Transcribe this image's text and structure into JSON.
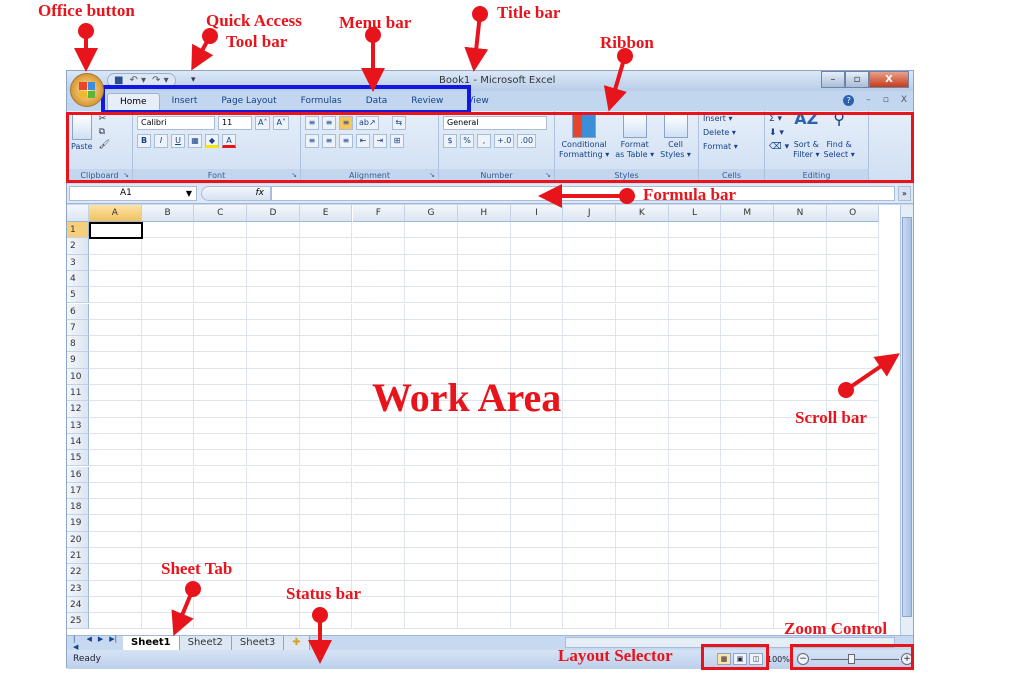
{
  "annotations": {
    "office_button": "Office button",
    "quick_access_line1": "Quick Access",
    "quick_access_line2": "Tool bar",
    "menu_bar": "Menu bar",
    "title_bar": "Title bar",
    "ribbon": "Ribbon",
    "formula_bar": "Formula bar",
    "work_area": "Work Area",
    "scroll_bar": "Scroll bar",
    "sheet_tab": "Sheet Tab",
    "status_bar": "Status bar",
    "zoom_control": "Zoom Control",
    "layout_selector": "Layout Selector",
    "colors": {
      "annotation": "#e8141c",
      "menu_highlight": "#1218e0"
    }
  },
  "window": {
    "title": "Book1 - Microsoft Excel",
    "controls": {
      "minimize": "–",
      "restore": "▫",
      "close": "X"
    },
    "mdi_controls": {
      "help": "?",
      "minimize": "–",
      "restore": "▫",
      "close": "X"
    }
  },
  "quick_access": {
    "save": "save-icon",
    "undo": "↶ ▾",
    "redo": "↷ ▾",
    "customize": "▾"
  },
  "menu": {
    "tabs": [
      {
        "label": "Home",
        "active": true
      },
      {
        "label": "Insert"
      },
      {
        "label": "Page Layout"
      },
      {
        "label": "Formulas"
      },
      {
        "label": "Data"
      },
      {
        "label": "Review"
      },
      {
        "label": "View"
      }
    ]
  },
  "ribbon": {
    "clipboard": {
      "label": "Clipboard",
      "paste": "Paste",
      "cut": "✂",
      "copy": "⧉",
      "format_painter": "🖌"
    },
    "font": {
      "label": "Font",
      "font_name": "Calibri",
      "font_size": "11",
      "grow": "A˄",
      "shrink": "A˅",
      "bold": "B",
      "italic": "I",
      "underline": "U",
      "borders": "▦",
      "fill": "◆",
      "font_color": "A"
    },
    "alignment": {
      "label": "Alignment",
      "top": "≡",
      "middle": "≡",
      "bottom": "≡",
      "orientation": "ab↗",
      "wrap": "⇆",
      "left": "≡",
      "center": "≡",
      "right": "≡",
      "dec_indent": "⇤",
      "inc_indent": "⇥",
      "merge": "⊞"
    },
    "number": {
      "label": "Number",
      "format": "General",
      "currency": "$",
      "percent": "%",
      "comma": ",",
      "inc_decimal": "+.0",
      "dec_decimal": ".00"
    },
    "styles": {
      "label": "Styles",
      "conditional": [
        "Conditional",
        "Formatting ▾"
      ],
      "format_table": [
        "Format",
        "as Table ▾"
      ],
      "cell_styles": [
        "Cell",
        "Styles ▾"
      ]
    },
    "cells": {
      "label": "Cells",
      "insert": "Insert ▾",
      "delete": "Delete ▾",
      "format": "Format ▾"
    },
    "editing": {
      "label": "Editing",
      "sum": "Σ ▾",
      "fill": "⬇ ▾",
      "clear": "⌫ ▾",
      "sort": [
        "Sort &",
        "Filter ▾"
      ],
      "find": [
        "Find &",
        "Select ▾"
      ]
    }
  },
  "formula_bar": {
    "name_box": "A1",
    "fx": "fx",
    "value": "",
    "expand": "»"
  },
  "grid": {
    "columns": [
      "A",
      "B",
      "C",
      "D",
      "E",
      "F",
      "G",
      "H",
      "I",
      "J",
      "K",
      "L",
      "M",
      "N",
      "O"
    ],
    "rows": [
      "1",
      "2",
      "3",
      "4",
      "5",
      "6",
      "7",
      "8",
      "9",
      "10",
      "11",
      "12",
      "13",
      "14",
      "15",
      "16",
      "17",
      "18",
      "19",
      "20",
      "21",
      "22",
      "23",
      "24",
      "25"
    ],
    "active_cell": "A1"
  },
  "sheets": {
    "nav": [
      "|◀",
      "◀",
      "▶",
      "▶|"
    ],
    "tabs": [
      {
        "label": "Sheet1",
        "active": true
      },
      {
        "label": "Sheet2"
      },
      {
        "label": "Sheet3"
      }
    ],
    "insert": "✚"
  },
  "status": {
    "text": "Ready",
    "zoom": "100%",
    "zoom_level_percent": 100,
    "zoom_minus": "−",
    "zoom_plus": "+"
  }
}
